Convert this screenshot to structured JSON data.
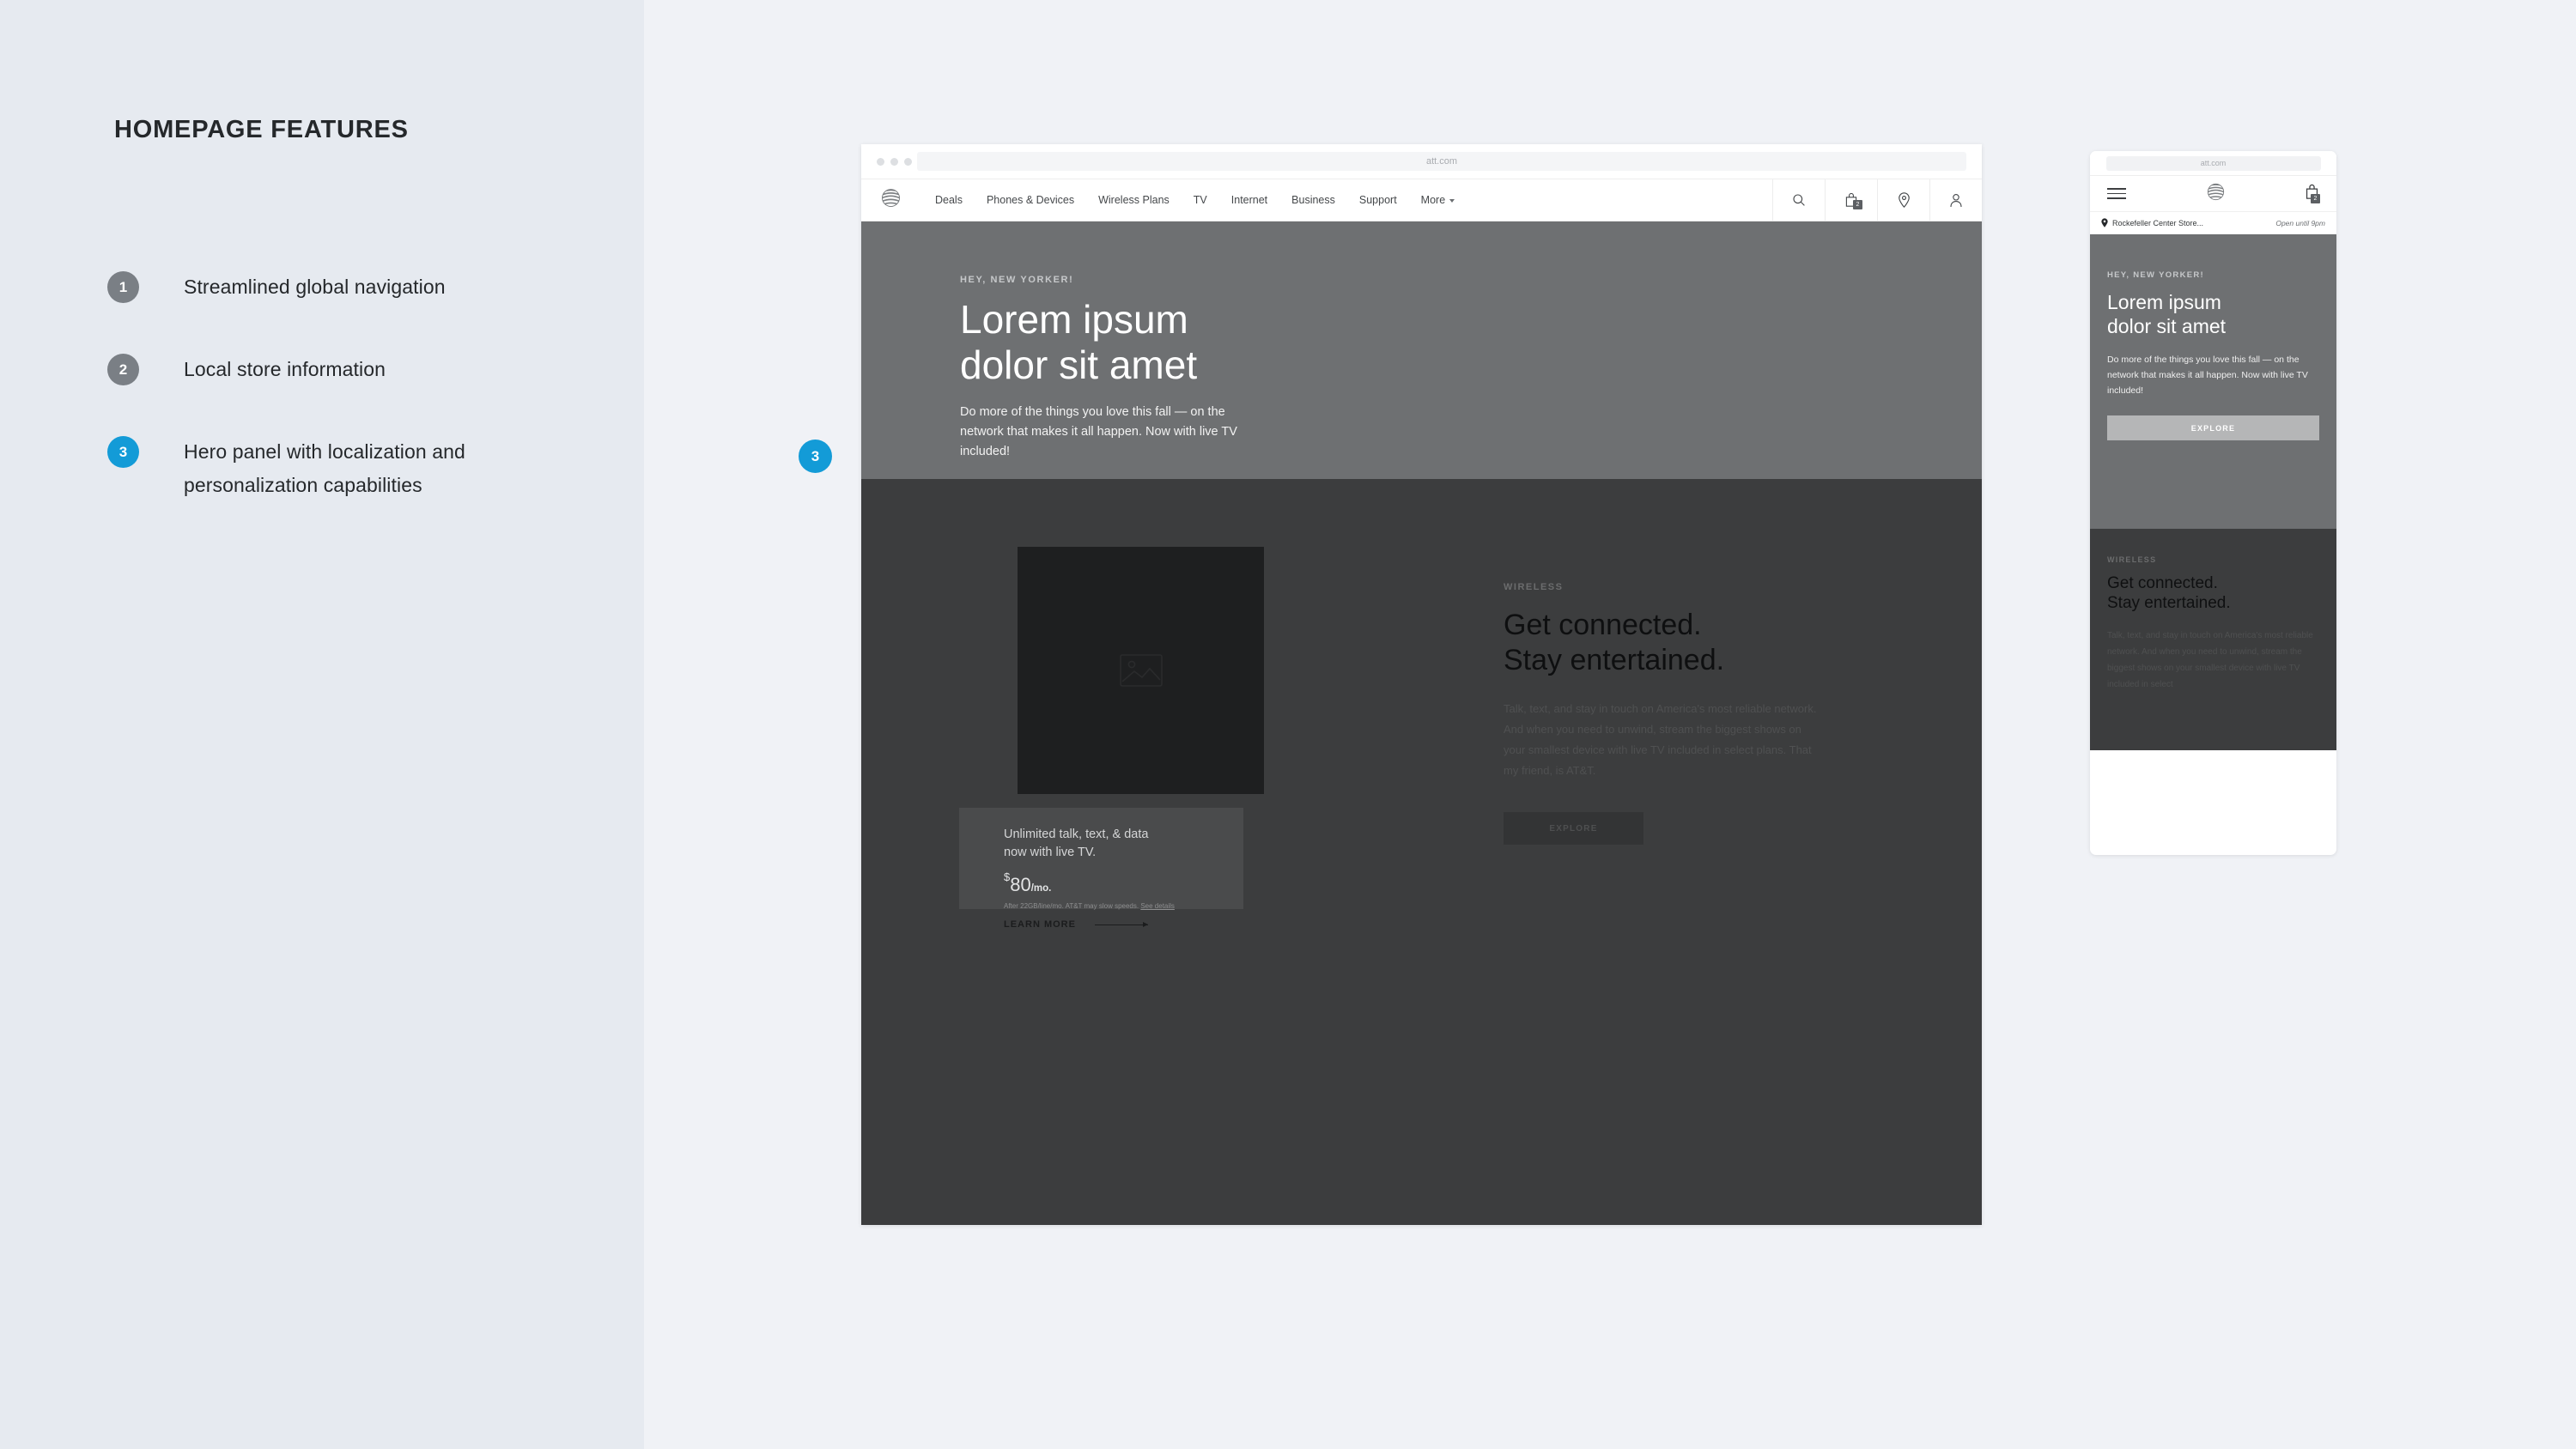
{
  "sidebar": {
    "title": "HOMEPAGE FEATURES",
    "features": [
      {
        "number": "1",
        "label": "Streamlined global navigation",
        "accent": false
      },
      {
        "number": "2",
        "label": "Local store information",
        "accent": false
      },
      {
        "number": "3",
        "label": "Hero panel with  localization and personalization capabilities",
        "accent": true
      }
    ]
  },
  "callout": {
    "number": "3"
  },
  "colors": {
    "accent": "#139bd7",
    "badge_gray": "#7a7f85",
    "hero_gray": "#6e7072",
    "dark": "#3c3d3e"
  },
  "desktop": {
    "browser": {
      "url": "att.com"
    },
    "nav": {
      "logo": "att-globe-logo",
      "links": [
        {
          "label": "Deals",
          "has_chevron": false
        },
        {
          "label": "Phones & Devices",
          "has_chevron": false
        },
        {
          "label": "Wireless Plans",
          "has_chevron": false
        },
        {
          "label": "TV",
          "has_chevron": false
        },
        {
          "label": "Internet",
          "has_chevron": false
        },
        {
          "label": "Business",
          "has_chevron": false
        },
        {
          "label": "Support",
          "has_chevron": false
        },
        {
          "label": "More",
          "has_chevron": true
        }
      ],
      "icons": [
        {
          "name": "search-icon",
          "badge": ""
        },
        {
          "name": "shopping-bag-icon",
          "badge": "2"
        },
        {
          "name": "location-pin-icon",
          "badge": ""
        },
        {
          "name": "account-person-icon",
          "badge": ""
        }
      ]
    },
    "hero": {
      "eyebrow": "HEY, NEW YORKER!",
      "heading_line1": "Lorem ipsum",
      "heading_line2": "dolor sit amet",
      "body": "Do more of the things you love this fall — on the network that makes it all happen. Now with live TV included!",
      "cta": "EXPLORE"
    },
    "wireless": {
      "eyebrow": "WIRELESS",
      "heading_line1": "Get connected.",
      "heading_line2": "Stay entertained.",
      "body": "Talk, text, and stay in touch on America's most reliable network. And when you need to unwind, stream the biggest shows on your smallest device with live TV included in select plans. That my friend, is AT&T.",
      "cta": "EXPLORE"
    },
    "promo_card": {
      "title_line1": "Unlimited talk, text, & data",
      "title_line2": "now with live TV.",
      "currency": "$",
      "price": "80",
      "period": "/mo.",
      "fine_print": "After 22GB/line/mo. AT&T may slow speeds.",
      "fine_print_link": "See details",
      "cta": "LEARN MORE"
    }
  },
  "mobile": {
    "browser": {
      "url": "att.com"
    },
    "nav": {
      "menu": "hamburger-menu-icon",
      "logo": "att-globe-logo",
      "bag_badge": "2"
    },
    "store_bar": {
      "name": "Rockefeller Center Store...",
      "hours": "Open until 9pm"
    },
    "hero": {
      "eyebrow": "HEY, NEW YORKER!",
      "heading_line1": "Lorem ipsum",
      "heading_line2": "dolor sit amet",
      "body": "Do more of the things you love this fall — on the network that makes it all happen. Now with live TV included!",
      "cta": "EXPLORE"
    },
    "wireless": {
      "eyebrow": "WIRELESS",
      "heading_line1": "Get connected.",
      "heading_line2": "Stay entertained.",
      "body": "Talk, text, and stay in touch on America's most reliable network. And when you need to unwind, stream the biggest shows on your smallest device with live TV included in select"
    }
  }
}
